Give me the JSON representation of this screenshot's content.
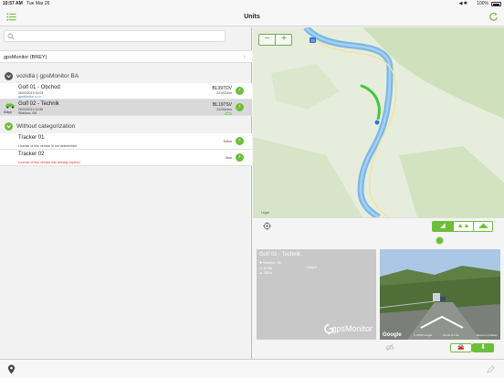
{
  "status_bar": {
    "time": "10:57 AM",
    "date": "Tue Mar 26",
    "battery": "100%",
    "signal": "◀ ✱"
  },
  "nav": {
    "title": "Units",
    "list_icon": "list-icon",
    "refresh_icon": "refresh-icon"
  },
  "search": {
    "placeholder": "",
    "value": ""
  },
  "company": {
    "label": "gpsMonitor (BREY)"
  },
  "groups": [
    {
      "name": "vozidlá | gpsMonitor BA",
      "units": [
        {
          "name": "Golf 01 - Obchod",
          "datetime": "26/03/2019 10:03",
          "extra": "gpsMonitor s.r.o",
          "plate": "BL397OV",
          "odometer": "221941km",
          "selected": false
        },
        {
          "name": "Golf 02 - Technik",
          "datetime": "26/03/2019 10:56",
          "address": "Strečno, SK",
          "speed": "84kph",
          "plate": "BL197SV",
          "odometer": "312984km",
          "selected": true
        }
      ]
    },
    {
      "name": "Without categorization",
      "trackers": [
        {
          "name": "Tracker 01",
          "license": "License of this vehicle is not determined",
          "distance": "54km",
          "expired": false
        },
        {
          "name": "Tracker 02",
          "license": "License of this vehicle has already expired",
          "distance": "0km",
          "expired": true
        }
      ]
    }
  ],
  "map": {
    "zoom_out": "−",
    "zoom_in": "+",
    "legal": "Legal",
    "road_marker": "18"
  },
  "map_tools": {
    "mode_labels": [
      "◢",
      "▲▲",
      "◢◣"
    ]
  },
  "info_card": {
    "title": "Golf 02 - Technik",
    "location": "Strečno, SK",
    "time": "10:56",
    "speed": "84kph",
    "altitude": "382m",
    "brand": "gpsMonitor"
  },
  "street_view": {
    "provider": "Google",
    "copyright": "© 2019 Google",
    "terms": "Terms of Use",
    "report": "Report a problem"
  },
  "actions": {
    "download_label": "⬇",
    "car_label": "🚘"
  },
  "colors": {
    "accent": "#6cbf3a",
    "route": "#42c838",
    "river": "#7ab8e8"
  }
}
